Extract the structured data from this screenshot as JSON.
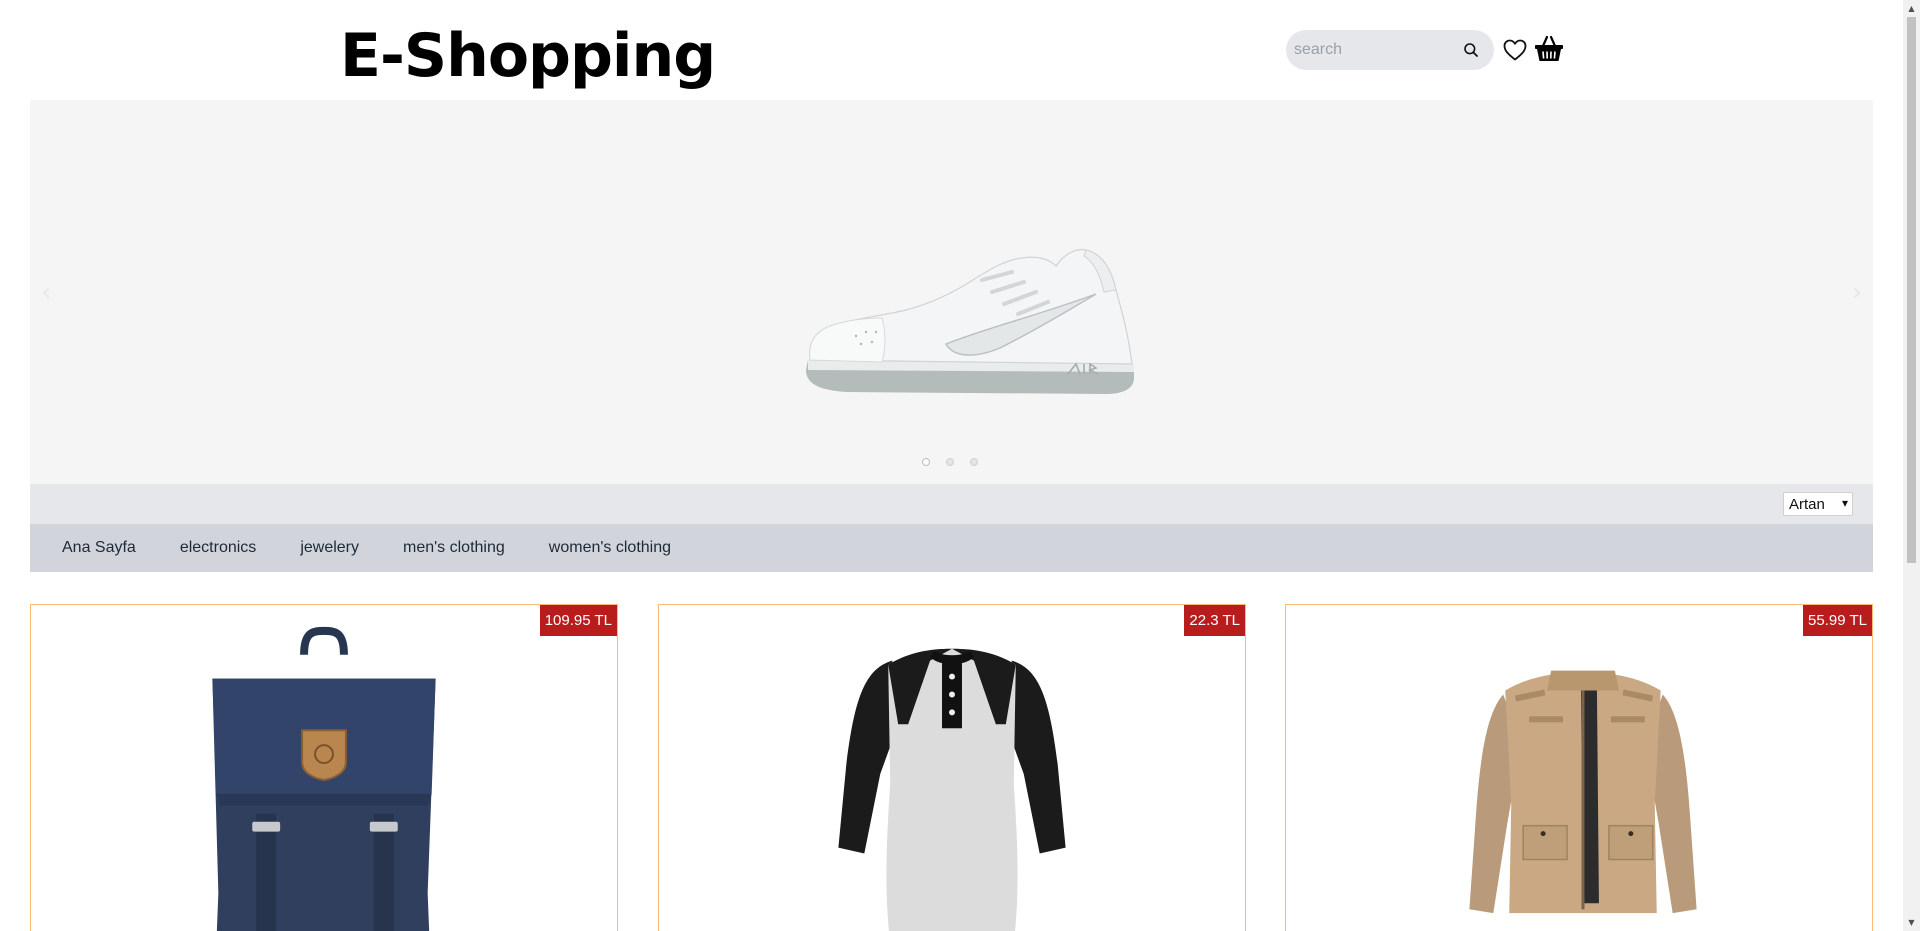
{
  "header": {
    "brand": "E-Shopping",
    "search_placeholder": "search"
  },
  "carousel": {
    "slide_count": 3,
    "active_index": 0,
    "slide_image": "white-sneaker"
  },
  "sort": {
    "selected": "Artan"
  },
  "categories": [
    {
      "label": "Ana Sayfa"
    },
    {
      "label": "electronics"
    },
    {
      "label": "jewelery"
    },
    {
      "label": "men's clothing"
    },
    {
      "label": "women's clothing"
    }
  ],
  "products": [
    {
      "price": "109.95 TL",
      "image": "navy-backpack"
    },
    {
      "price": "22.3 TL",
      "image": "raglan-henley-shirt"
    },
    {
      "price": "55.99 TL",
      "image": "khaki-jacket"
    }
  ],
  "colors": {
    "price_badge": "#b91c1c",
    "card_border": "#fdba74",
    "sort_bar": "#e5e7eb",
    "category_bar": "#d1d5db",
    "carousel_bg": "#f5f5f5"
  },
  "icons": {
    "search": "search-icon",
    "wishlist": "heart-icon",
    "cart": "basket-icon"
  }
}
